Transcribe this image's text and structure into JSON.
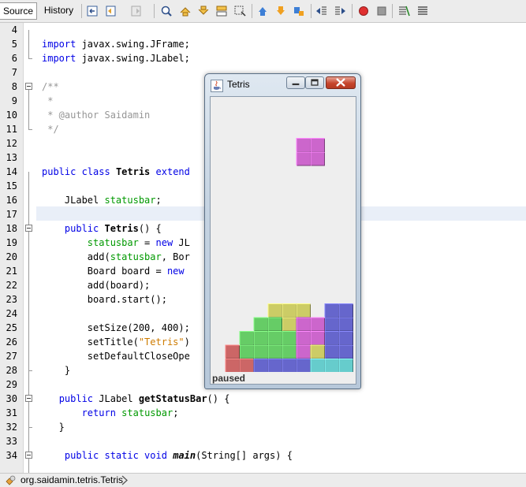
{
  "toolbar": {
    "tabs": [
      {
        "label": "Source"
      },
      {
        "label": "History"
      }
    ],
    "buttons": [
      "last-edit-icon",
      "back-icon",
      "forward-icon",
      "find-icon",
      "find-previous-icon",
      "find-next-icon",
      "find-selection-icon",
      "toggle-highlight-icon",
      "previous-bookmark-icon",
      "next-bookmark-icon",
      "toggle-bookmark-icon",
      "shift-left-icon",
      "shift-right-icon",
      "start-macro-icon",
      "stop-macro-icon",
      "comment-icon",
      "uncomment-icon"
    ]
  },
  "editor": {
    "current_line": 17,
    "lines": [
      {
        "n": "4",
        "html": ""
      },
      {
        "n": "5",
        "html": "<span class=\"kw\">import</span> javax.swing.JFrame;"
      },
      {
        "n": "6",
        "html": "<span class=\"kw\">import</span> javax.swing.JLabel;"
      },
      {
        "n": "7",
        "html": ""
      },
      {
        "n": "8",
        "html": "<span class=\"com\">/**</span>"
      },
      {
        "n": "9",
        "html": "<span class=\"com\"> *</span>"
      },
      {
        "n": "10",
        "html": "<span class=\"com\"> * @author Saidamin</span>"
      },
      {
        "n": "11",
        "html": "<span class=\"com\"> */</span>"
      },
      {
        "n": "12",
        "html": ""
      },
      {
        "n": "13",
        "html": ""
      },
      {
        "n": "14",
        "html": "<span class=\"kw\">public class</span> <span class=\"b\">Tetris</span> <span class=\"kw\">extend</span>"
      },
      {
        "n": "15",
        "html": ""
      },
      {
        "n": "16",
        "html": "    JLabel <span class=\"field\">statusbar</span>;"
      },
      {
        "n": "17",
        "html": ""
      },
      {
        "n": "18",
        "html": "    <span class=\"kw\">public</span> <span class=\"b\">Tetris</span>() {"
      },
      {
        "n": "19",
        "html": "        <span class=\"field\">statusbar</span> = <span class=\"kw\">new</span> JL"
      },
      {
        "n": "20",
        "html": "        add(<span class=\"field\">statusbar</span>, Bor"
      },
      {
        "n": "21",
        "html": "        Board board = <span class=\"kw\">new</span>"
      },
      {
        "n": "22",
        "html": "        add(board);"
      },
      {
        "n": "23",
        "html": "        board.start();"
      },
      {
        "n": "24",
        "html": ""
      },
      {
        "n": "25",
        "html": "        setSize(200, 400);"
      },
      {
        "n": "26",
        "html": "        setTitle(<span class=\"str\">\"Tetris\"</span>)"
      },
      {
        "n": "27",
        "html": "        setDefaultCloseOpe"
      },
      {
        "n": "28",
        "html": "    }"
      },
      {
        "n": "29",
        "html": ""
      },
      {
        "n": "30",
        "html": "   <span class=\"kw\">public</span> JLabel <span class=\"b\">getStatusBar</span>() {"
      },
      {
        "n": "31",
        "html": "       <span class=\"kw\">return</span> <span class=\"field\">statusbar</span>;"
      },
      {
        "n": "32",
        "html": "   }"
      },
      {
        "n": "33",
        "html": ""
      },
      {
        "n": "34",
        "html": "    <span class=\"kw\">public static void</span> <span class=\"b it\">main</span>(String[] args) {"
      }
    ]
  },
  "statusbar": {
    "breadcrumb": "org.saidamin.tetris.Tetris"
  },
  "tetris_window": {
    "title": "Tetris",
    "status": "paused",
    "colors": {
      "magenta": "#cc66cc",
      "green": "#66cc66",
      "yellow": "#cccc66",
      "blue": "#6666cc",
      "red": "#cc6666",
      "cyan": "#66cccc"
    },
    "falling_piece": {
      "shape": "square",
      "color": "magenta",
      "cells": [
        [
          6,
          3
        ],
        [
          7,
          3
        ],
        [
          6,
          4
        ],
        [
          7,
          4
        ]
      ]
    },
    "stack": [
      {
        "color": "yellow",
        "cells": [
          [
            4,
            15
          ],
          [
            5,
            15
          ],
          [
            6,
            15
          ],
          [
            5,
            16
          ]
        ]
      },
      {
        "color": "blue",
        "cells": [
          [
            8,
            15
          ],
          [
            9,
            15
          ],
          [
            8,
            16
          ],
          [
            9,
            16
          ],
          [
            8,
            17
          ],
          [
            9,
            17
          ],
          [
            8,
            18
          ],
          [
            9,
            18
          ]
        ]
      },
      {
        "color": "green",
        "cells": [
          [
            3,
            16
          ],
          [
            4,
            16
          ],
          [
            2,
            17
          ],
          [
            3,
            17
          ],
          [
            4,
            17
          ],
          [
            5,
            17
          ],
          [
            2,
            18
          ],
          [
            3,
            18
          ],
          [
            4,
            18
          ],
          [
            5,
            18
          ]
        ]
      },
      {
        "color": "magenta",
        "cells": [
          [
            6,
            16
          ],
          [
            7,
            16
          ],
          [
            6,
            17
          ],
          [
            7,
            17
          ],
          [
            6,
            18
          ]
        ]
      },
      {
        "color": "yellow",
        "cells": [
          [
            7,
            18
          ]
        ]
      },
      {
        "color": "red",
        "cells": [
          [
            1,
            18
          ],
          [
            1,
            19
          ],
          [
            2,
            19
          ]
        ]
      },
      {
        "color": "blue",
        "cells": [
          [
            3,
            19
          ],
          [
            4,
            19
          ],
          [
            5,
            19
          ],
          [
            6,
            19
          ]
        ]
      },
      {
        "color": "cyan",
        "cells": [
          [
            7,
            19
          ],
          [
            8,
            19
          ],
          [
            9,
            19
          ]
        ]
      }
    ]
  }
}
